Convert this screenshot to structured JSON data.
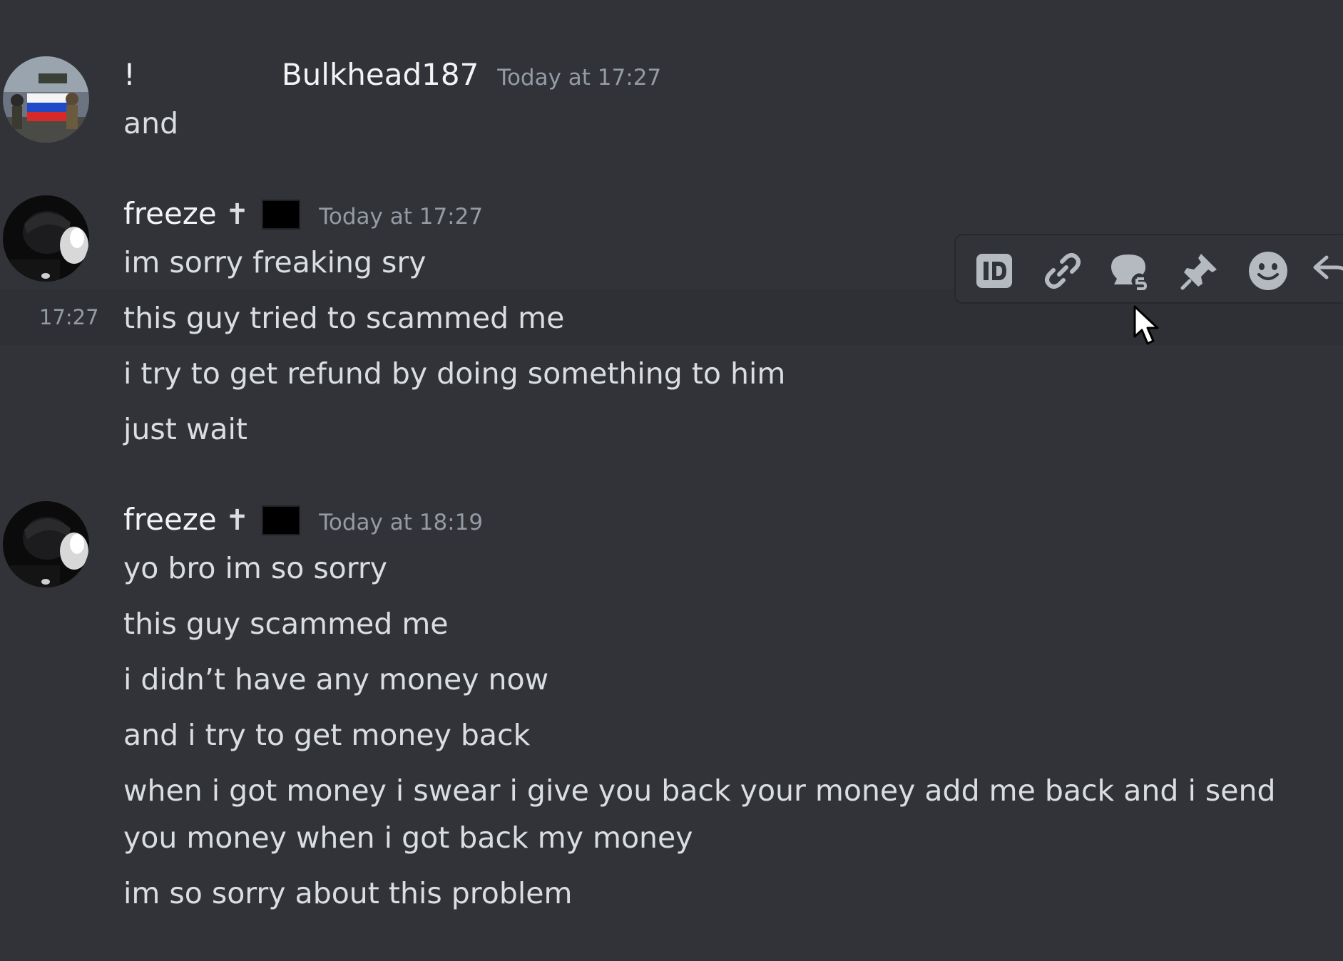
{
  "messages": [
    {
      "prefix": "!",
      "username": "Bulkhead187",
      "timestamp": "Today at 17:27",
      "lines": [
        "and"
      ]
    },
    {
      "username": "freeze",
      "badge": "✝",
      "timestamp": "Today at 17:27",
      "lines": [
        "im sorry freaking sry",
        "this guy tried to scammed me",
        "i try to get refund by doing something to him",
        "just wait"
      ],
      "hover_time": "17:27"
    },
    {
      "username": "freeze",
      "badge": "✝",
      "timestamp": "Today at 18:19",
      "lines": [
        "yo bro im so sorry",
        "this guy scammed me",
        "i didn’t have any money now",
        "and i try to get money back",
        "when i got money i swear i give you back your money add me back and i send you money when i got back my money",
        "im so sorry about this problem"
      ]
    }
  ],
  "toolbar": {
    "icons": [
      "id-icon",
      "link-icon",
      "thread-icon",
      "pin-icon",
      "emoji-icon",
      "reply-icon"
    ]
  },
  "colors": {
    "background": "#313338",
    "hover_row": "#2e3035",
    "username": "#f2f3f5",
    "timestamp": "#949ba4",
    "text": "#dbdee1"
  }
}
